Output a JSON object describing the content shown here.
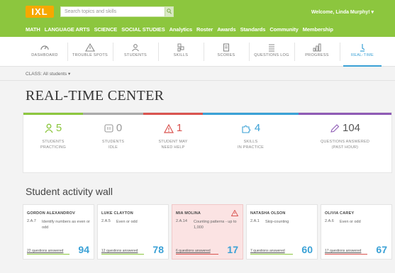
{
  "header": {
    "logo_text": "IXL",
    "search_placeholder": "Search topics and skills",
    "welcome": "Welcome, Linda Murphy! ▾",
    "nav": [
      "MATH",
      "LANGUAGE ARTS",
      "SCIENCE",
      "SOCIAL STUDIES",
      "Analytics",
      "Roster",
      "Awards",
      "Standards",
      "Community",
      "Membership"
    ]
  },
  "subnav": {
    "items": [
      {
        "label": "DASHBOARD",
        "icon": "gauge-icon"
      },
      {
        "label": "TROUBLE SPOTS",
        "icon": "warning-icon"
      },
      {
        "label": "STUDENTS",
        "icon": "students-icon"
      },
      {
        "label": "SKILLS",
        "icon": "skills-icon"
      },
      {
        "label": "SCORES",
        "icon": "scores-icon"
      },
      {
        "label": "QUESTIONS LOG",
        "icon": "list-icon"
      },
      {
        "label": "PROGRESS",
        "icon": "progress-icon"
      },
      {
        "label": "REAL-TIME",
        "icon": "realtime-icon"
      }
    ],
    "active": "REAL-TIME"
  },
  "classbar": {
    "label": "CLASS: All students ▾"
  },
  "page": {
    "title": "REAL-TIME CENTER"
  },
  "stats": [
    {
      "value": "5",
      "line1": "STUDENTS",
      "line2": "PRACTICING",
      "color": "#8cc63e",
      "icon": "students-practicing-icon"
    },
    {
      "value": "0",
      "line1": "STUDENTS",
      "line2": "IDLE",
      "color": "#aaaaaa",
      "icon": "idle-icon"
    },
    {
      "value": "1",
      "line1": "STUDENT MAY",
      "line2": "NEED HELP",
      "color": "#d9534f",
      "icon": "alert-icon"
    },
    {
      "value": "4",
      "line1": "SKILLS",
      "line2": "IN PRACTICE",
      "color": "#3aa1d6",
      "icon": "puzzle-icon"
    },
    {
      "value": "104",
      "line1": "QUESTIONS ANSWERED",
      "line2": "(PAST HOUR)",
      "color": "#8e5bb5",
      "icon": "pencil-icon"
    }
  ],
  "wall": {
    "title": "Student activity wall",
    "cards": [
      {
        "name": "GORDON ALEXANDROV",
        "code": "2.A.7",
        "skill": "Identify numbers as even or odd",
        "answered": "22 questions answered",
        "score": "94",
        "bar_color": "#8cc63e",
        "alert": false
      },
      {
        "name": "LUKE CLAYTON",
        "code": "2.A.5",
        "skill": "Even or odd",
        "answered": "12 questions answered",
        "score": "78",
        "bar_color": "#8cc63e",
        "alert": false
      },
      {
        "name": "MIA MOLINA",
        "code": "2.A.14",
        "skill": "Counting patterns - up to 1,000",
        "answered": "6 questions answered",
        "score": "17",
        "bar_color": "#d9534f",
        "alert": true
      },
      {
        "name": "NATASHA OLSON",
        "code": "2.A.1",
        "skill": "Skip-counting",
        "answered": "7 questions answered",
        "score": "60",
        "bar_color": "#8cc63e",
        "alert": false
      },
      {
        "name": "OLIVIA CAREY",
        "code": "2.A.6",
        "skill": "Even or odd",
        "answered": "17 questions answered",
        "score": "67",
        "bar_color": "#d9534f",
        "alert": false
      }
    ]
  }
}
